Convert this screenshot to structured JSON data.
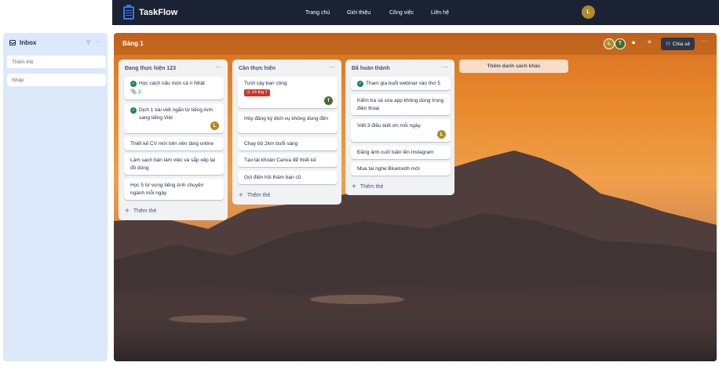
{
  "app": {
    "brand": "TaskFlow",
    "nav": [
      "Trang chủ",
      "Giới thiệu",
      "Công việc",
      "Liên hệ"
    ],
    "user_initial": "L"
  },
  "sidebar": {
    "title": "Inbox",
    "items": [
      "Thêm thẻ",
      "Nháp"
    ]
  },
  "board": {
    "title": "Bảng 1",
    "members": [
      "L",
      "T"
    ],
    "share_label": "Chia sẻ",
    "add_list_label": "Thêm danh sách khác",
    "lists": [
      {
        "title": "Đang thực hiện 123",
        "add_label": "Thêm thẻ",
        "cards": [
          {
            "text": "Học cách nấu món cá ri Nhật",
            "done": true,
            "attachments": "2"
          },
          {
            "text": "Dịch 1 bài viết ngắn từ tiếng Anh sang tiếng Việt",
            "done": true,
            "member": "L"
          },
          {
            "text": "Thiết kế CV mới trên nền tảng online"
          },
          {
            "text": "Làm sạch bàn làm việc và sắp xếp lại đồ dùng"
          },
          {
            "text": "Học 5 từ vựng tiếng Anh chuyên ngành mỗi ngày"
          }
        ]
      },
      {
        "title": "Cần thực hiện",
        "add_label": "Thêm thẻ",
        "cards": [
          {
            "text": "Tưới cây ban công",
            "due": "14 thg 7",
            "member": "T"
          },
          {
            "text": "Hủy đăng ký dịch vụ không dùng đến"
          },
          {
            "text": "Chạy bộ 2km buổi sáng"
          },
          {
            "text": "Tạo tài khoản Canva để thiết kế"
          },
          {
            "text": "Gọi điện hỏi thăm bạn cũ"
          }
        ]
      },
      {
        "title": "Đã hoàn thành",
        "add_label": "Thêm thẻ",
        "cards": [
          {
            "text": "Tham gia buổi webinar vào thứ 5",
            "done": true
          },
          {
            "text": "Kiểm tra và xóa app không dùng trong điện thoại"
          },
          {
            "text": "Viết 3 điều biết ơn mỗi ngày",
            "member": "L"
          },
          {
            "text": "Đăng ảnh cuối tuần lên Instagram"
          },
          {
            "text": "Mua tai nghe Bluetooth mới"
          }
        ]
      }
    ]
  },
  "colors": {
    "topbar": "#1a2233",
    "sidebar": "#dce9fb",
    "accent": "#2f7cf0",
    "done": "#1f845a",
    "due": "#c9372c",
    "avatar_l": "#b08b2a",
    "avatar_t": "#4a6b2a"
  }
}
